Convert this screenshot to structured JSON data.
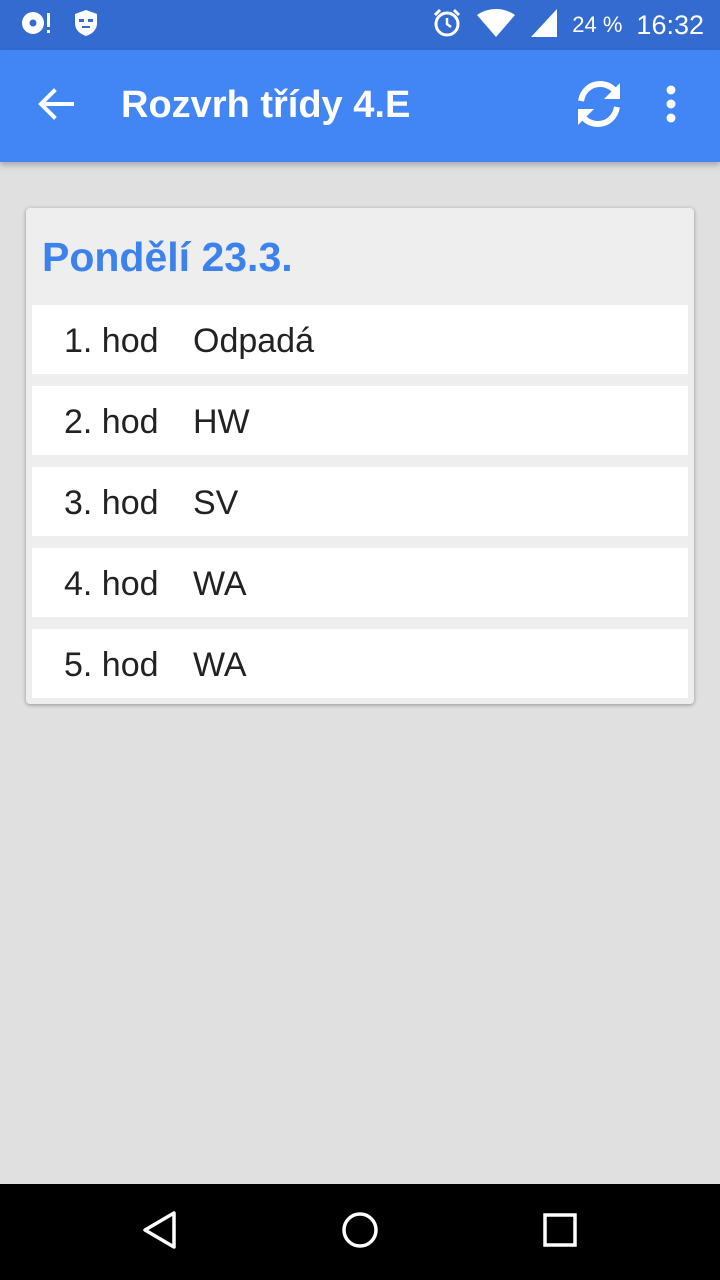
{
  "status_bar": {
    "icons_left": [
      "music-notification-icon",
      "guard-notification-icon"
    ],
    "icons_right": [
      "alarm-icon",
      "wifi-icon",
      "cell-signal-icon"
    ],
    "battery": "24 %",
    "time": "16:32",
    "background_color": "#346bd0"
  },
  "app_bar": {
    "title": "Rozvrh třídy 4.E",
    "back_icon": "arrow-back-icon",
    "refresh_icon": "refresh-icon",
    "menu_icon": "more-vert-icon",
    "background_color": "#4285f4"
  },
  "day_card": {
    "title": "Pondělí 23.3.",
    "title_color": "#3d82ec",
    "lessons": [
      {
        "hour": "1. hod",
        "subject": "Odpadá"
      },
      {
        "hour": "2. hod",
        "subject": "HW"
      },
      {
        "hour": "3. hod",
        "subject": "SV"
      },
      {
        "hour": "4. hod",
        "subject": "WA"
      },
      {
        "hour": "5. hod",
        "subject": "WA"
      }
    ]
  },
  "nav_bar": {
    "buttons": [
      "back-triangle-icon",
      "home-circle-icon",
      "recents-square-icon"
    ]
  }
}
